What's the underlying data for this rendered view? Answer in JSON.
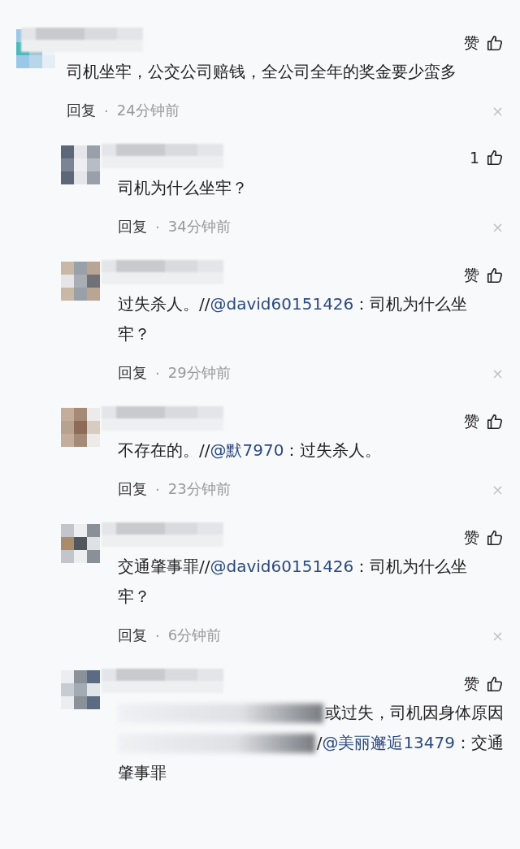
{
  "comments": [
    {
      "likes": "赞",
      "segments": [
        {
          "text": "司机坐牢，公交公司赔钱，全公司全年的奖金要少蛮多"
        }
      ],
      "reply_label": "回复",
      "dot": "·",
      "time": "24分钟前",
      "dismiss": "×",
      "replies": [
        {
          "likes": "1",
          "segments": [
            {
              "text": "司机为什么坐牢？"
            }
          ],
          "reply_label": "回复",
          "dot": "·",
          "time": "34分钟前",
          "dismiss": "×"
        },
        {
          "likes": "赞",
          "segments": [
            {
              "text": "过失杀人。//"
            },
            {
              "mention": "@david60151426"
            },
            {
              "text": "：司机为什么坐牢？"
            }
          ],
          "reply_label": "回复",
          "dot": "·",
          "time": "29分钟前",
          "dismiss": "×"
        },
        {
          "likes": "赞",
          "segments": [
            {
              "text": "不存在的。//"
            },
            {
              "mention": "@默7970"
            },
            {
              "text": "：过失杀人。"
            }
          ],
          "reply_label": "回复",
          "dot": "·",
          "time": "23分钟前",
          "dismiss": "×"
        },
        {
          "likes": "赞",
          "segments": [
            {
              "text": "交通肇事罪//"
            },
            {
              "mention": "@david60151426"
            },
            {
              "text": "：司机为什么坐牢？"
            }
          ],
          "reply_label": "回复",
          "dot": "·",
          "time": "6分钟前",
          "dismiss": "×"
        },
        {
          "likes": "赞",
          "lines": [
            {
              "obscured": true,
              "segments": [
                {
                  "text": "或过失，司机因身体原因"
                }
              ]
            },
            {
              "obscured": true,
              "segments": [
                {
                  "text": "/"
                },
                {
                  "mention": "@美丽邂逅13479"
                },
                {
                  "text": "：交通"
                }
              ]
            },
            {
              "obscured": false,
              "segments": [
                {
                  "text": "肇事罪"
                }
              ]
            }
          ]
        }
      ]
    }
  ]
}
